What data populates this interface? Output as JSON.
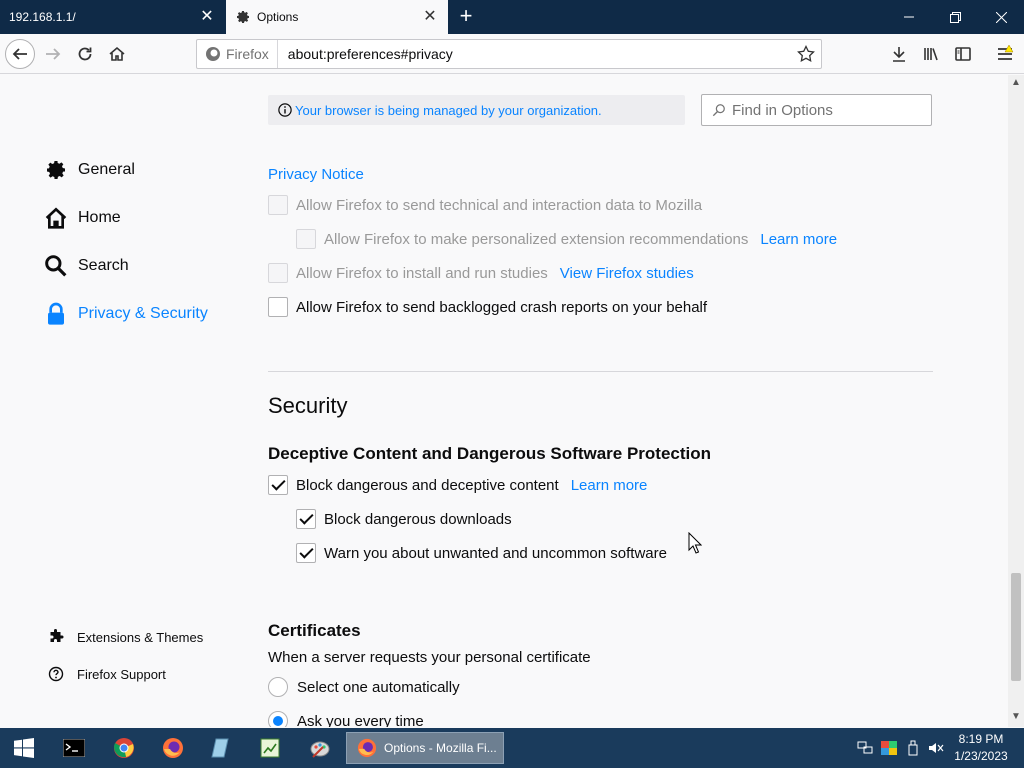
{
  "tabs": [
    {
      "label": "192.168.1.1/",
      "active": false
    },
    {
      "label": "Options",
      "active": true
    }
  ],
  "navbar": {
    "identity_label": "Firefox",
    "url": "about:preferences#privacy"
  },
  "policy_notice": "Your browser is being managed by your organization.",
  "find": {
    "placeholder": "Find in Options"
  },
  "sidebar": {
    "items": [
      {
        "label": "General",
        "icon": "gear-icon",
        "selected": false
      },
      {
        "label": "Home",
        "icon": "home-icon",
        "selected": false
      },
      {
        "label": "Search",
        "icon": "search-icon",
        "selected": false
      },
      {
        "label": "Privacy & Security",
        "icon": "lock-icon",
        "selected": true
      }
    ],
    "footer": [
      {
        "label": "Extensions & Themes",
        "icon": "puzzle-icon"
      },
      {
        "label": "Firefox Support",
        "icon": "help-icon"
      }
    ]
  },
  "data_collection": {
    "privacy_notice_link": "Privacy Notice",
    "technical_data": {
      "label": "Allow Firefox to send technical and interaction data to Mozilla",
      "checked": false,
      "disabled": true
    },
    "extension_recs": {
      "label": "Allow Firefox to make personalized extension recommendations",
      "checked": false,
      "disabled": true,
      "link": "Learn more"
    },
    "studies": {
      "label": "Allow Firefox to install and run studies",
      "checked": false,
      "disabled": true,
      "link": "View Firefox studies"
    },
    "crash_reports": {
      "label": "Allow Firefox to send backlogged crash reports on your behalf",
      "checked": false,
      "disabled": false
    }
  },
  "security": {
    "heading": "Security",
    "deceptive_heading": "Deceptive Content and Dangerous Software Protection",
    "block_deceptive": {
      "label": "Block dangerous and deceptive content",
      "checked": true,
      "link": "Learn more"
    },
    "block_downloads": {
      "label": "Block dangerous downloads",
      "checked": true
    },
    "warn_unwanted": {
      "label": "Warn you about unwanted and uncommon software",
      "checked": true
    }
  },
  "certificates": {
    "heading": "Certificates",
    "description": "When a server requests your personal certificate",
    "options": [
      {
        "label": "Select one automatically",
        "selected": false
      },
      {
        "label": "Ask you every time",
        "selected": true
      }
    ]
  },
  "taskbar": {
    "active_window_label": "Options - Mozilla Fi...",
    "clock_time": "8:19 PM",
    "clock_date": "1/23/2023"
  },
  "colors": {
    "accent": "#0a84ff",
    "tabbar": "#0f2a47",
    "taskbar": "#1a3b5c"
  }
}
